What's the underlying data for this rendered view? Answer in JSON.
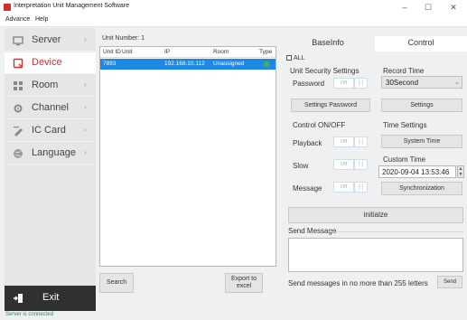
{
  "window": {
    "title": "Interpretation Unit Management Software",
    "controls": {
      "minimize": "–",
      "maximize": "☐",
      "close": "✕"
    }
  },
  "menu": {
    "advance": "Advance",
    "help": "Help"
  },
  "sidebar": {
    "items": [
      {
        "label": "Server",
        "icon": "server-icon"
      },
      {
        "label": "Device",
        "icon": "device-icon",
        "active": true
      },
      {
        "label": "Room",
        "icon": "room-icon"
      },
      {
        "label": "Channel",
        "icon": "channel-icon"
      },
      {
        "label": "IC Card",
        "icon": "ic-card-icon"
      },
      {
        "label": "Language",
        "icon": "globe-icon"
      }
    ],
    "chevron": "›",
    "exit": "Exit"
  },
  "units": {
    "number_label": "Unit Number: 1",
    "columns": [
      "Unit ID",
      "Unit",
      "IP",
      "Room",
      "Type"
    ],
    "rows": [
      {
        "unit_id": "7893",
        "unit": "",
        "ip": "192.168.10.112",
        "room": "Unassigned",
        "type": "online"
      }
    ],
    "search": "Search",
    "export": "Export to excel"
  },
  "tabs": {
    "baseinfo": "BaseInfo",
    "control": "Control"
  },
  "control": {
    "all_label": "ALL",
    "security_title": "Unit Security Settings",
    "password_label": "Password",
    "settings_password": "Settings Password",
    "onoff_title": "Control ON/OFF",
    "playback_label": "Playback",
    "slow_label": "Slow",
    "message_label": "Message",
    "toggle_off": "Off",
    "toggle_knob": "| |",
    "record_time_title": "Record Time",
    "record_time_value": "30Second",
    "dropdown_arrow": "⌄",
    "settings": "Settings",
    "time_settings_title": "Time Settings",
    "system_time": "System Time",
    "custom_time_title": "Custom Time",
    "custom_time_value": "2020-09-04 13:53:46",
    "spin_up": "▲",
    "spin_down": "▼",
    "synchronization": "Synchronization",
    "initialize": "initialze",
    "send_message_title": "Send Message",
    "send_hint": "Send messages in no more than 255 letters",
    "send": "Send"
  },
  "status": {
    "text": "Server is connected"
  },
  "colors": {
    "accent": "#d32f2f",
    "selection": "#1e88e5",
    "online": "#4caf50",
    "exit_bg": "#303030",
    "status_text": "#2e8b57"
  }
}
